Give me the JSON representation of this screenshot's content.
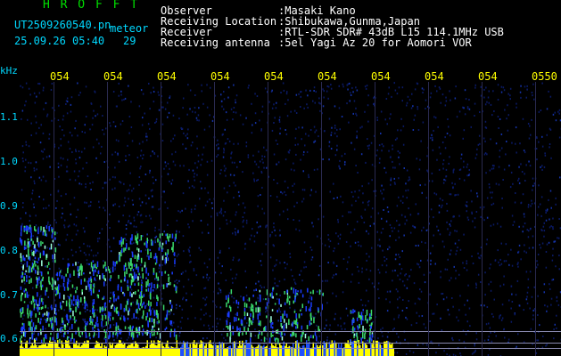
{
  "header": {
    "logo": "H R O F F T",
    "filename": "UT2509260540.pn",
    "meteor_label": "meteor",
    "datetime": "25.09.26 05:40",
    "meteor_count": "29"
  },
  "info": [
    {
      "label": "Observer",
      "value": ":Masaki Kano"
    },
    {
      "label": "Receiving Location",
      "value": ":Shibukawa,Gunma,Japan"
    },
    {
      "label": "Receiver",
      "value": ":RTL-SDR SDR# 43dB L15 114.1MHz USB"
    },
    {
      "label": "Receiving antenna",
      "value": ":5el Yagi Az 20 for Aomori VOR"
    }
  ],
  "axis": {
    "unit": "kHz",
    "y_ticks": [
      "1.1",
      "1.0",
      "0.9",
      "0.8",
      "0.7",
      "0.6"
    ],
    "x_ticks": [
      "054",
      "054",
      "054",
      "054",
      "054",
      "054",
      "054",
      "054",
      "054",
      "0550"
    ]
  },
  "colors": {
    "text_cyan": "#00d8ff",
    "text_green": "#00e000",
    "tick_yellow": "#ffff00",
    "background": "#000000",
    "signal_green": "#3ad86b",
    "signal_blue": "#1a3cff",
    "noise_yellow": "#ffff00"
  }
}
